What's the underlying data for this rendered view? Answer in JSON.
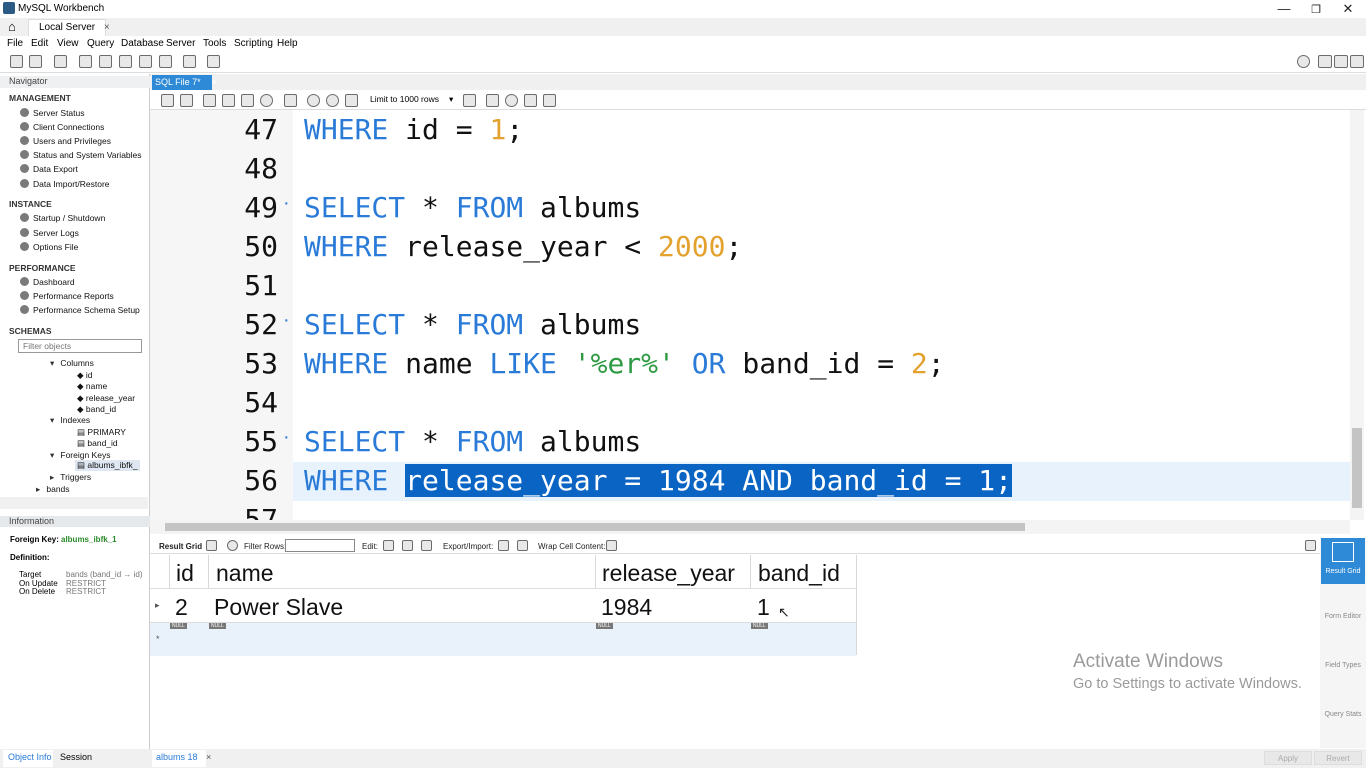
{
  "window": {
    "title": "MySQL Workbench",
    "minimize": "—",
    "restore": "❐",
    "close": "✕"
  },
  "connection_tab": {
    "label": "Local Server",
    "close": "×",
    "home": "⌂"
  },
  "menu": [
    "File",
    "Edit",
    "View",
    "Query",
    "Database",
    "Server",
    "Tools",
    "Scripting",
    "Help"
  ],
  "navigator": {
    "title": "Navigator",
    "management_header": "MANAGEMENT",
    "management_items": [
      "Server Status",
      "Client Connections",
      "Users and Privileges",
      "Status and System Variables",
      "Data Export",
      "Data Import/Restore"
    ],
    "instance_header": "INSTANCE",
    "instance_items": [
      "Startup / Shutdown",
      "Server Logs",
      "Options File"
    ],
    "performance_header": "PERFORMANCE",
    "performance_items": [
      "Dashboard",
      "Performance Reports",
      "Performance Schema Setup"
    ],
    "schemas_header": "SCHEMAS",
    "filter_placeholder": "Filter objects",
    "tree": {
      "columns": "Columns",
      "col_id": "id",
      "col_name": "name",
      "col_release": "release_year",
      "col_band": "band_id",
      "indexes": "Indexes",
      "idx_primary": "PRIMARY",
      "idx_band": "band_id",
      "foreign_keys": "Foreign Keys",
      "fk": "albums_ibfk_",
      "triggers": "Triggers",
      "bands": "bands"
    }
  },
  "information": {
    "header": "Information",
    "fk_label": "Foreign Key:",
    "fk_value": "albums_ibfk_1",
    "definition": "Definition:",
    "target_label": "Target",
    "target_value": "bands (band_id → id)",
    "onupdate_label": "On Update",
    "onupdate_value": "RESTRICT",
    "ondelete_label": "On Delete",
    "ondelete_value": "RESTRICT"
  },
  "bottom_tabs": {
    "object_info": "Object Info",
    "session": "Session"
  },
  "sql_tab": {
    "label": "SQL File 7*",
    "close": "×"
  },
  "editor_toolbar": {
    "limit": "Limit to 1000 rows"
  },
  "editor": {
    "lines": [
      {
        "n": "47",
        "code": [
          {
            "t": "WHERE",
            "c": "kw"
          },
          {
            "t": " id = ",
            "c": ""
          },
          {
            "t": "1",
            "c": "num"
          },
          {
            "t": ";",
            "c": ""
          }
        ]
      },
      {
        "n": "48",
        "code": []
      },
      {
        "n": "49",
        "code": [
          {
            "t": "SELECT",
            "c": "kw"
          },
          {
            "t": " * ",
            "c": ""
          },
          {
            "t": "FROM",
            "c": "kw"
          },
          {
            "t": " albums",
            "c": ""
          }
        ],
        "dot": true
      },
      {
        "n": "50",
        "code": [
          {
            "t": "WHERE",
            "c": "kw"
          },
          {
            "t": " release_year < ",
            "c": ""
          },
          {
            "t": "2000",
            "c": "num"
          },
          {
            "t": ";",
            "c": ""
          }
        ]
      },
      {
        "n": "51",
        "code": []
      },
      {
        "n": "52",
        "code": [
          {
            "t": "SELECT",
            "c": "kw"
          },
          {
            "t": " * ",
            "c": ""
          },
          {
            "t": "FROM",
            "c": "kw"
          },
          {
            "t": " albums",
            "c": ""
          }
        ],
        "dot": true
      },
      {
        "n": "53",
        "code": [
          {
            "t": "WHERE",
            "c": "kw"
          },
          {
            "t": " name ",
            "c": ""
          },
          {
            "t": "LIKE",
            "c": "kw"
          },
          {
            "t": " ",
            "c": ""
          },
          {
            "t": "'%er%'",
            "c": "str"
          },
          {
            "t": " ",
            "c": ""
          },
          {
            "t": "OR",
            "c": "kw"
          },
          {
            "t": " band_id = ",
            "c": ""
          },
          {
            "t": "2",
            "c": "num"
          },
          {
            "t": ";",
            "c": ""
          }
        ]
      },
      {
        "n": "54",
        "code": []
      },
      {
        "n": "55",
        "code": [
          {
            "t": "SELECT",
            "c": "kw"
          },
          {
            "t": " * ",
            "c": ""
          },
          {
            "t": "FROM",
            "c": "kw"
          },
          {
            "t": " albums",
            "c": ""
          }
        ],
        "dot": true
      },
      {
        "n": "56",
        "code": [
          {
            "t": "WHERE",
            "c": "kw"
          },
          {
            "t": " ",
            "c": ""
          },
          {
            "t": "release_year = 1984 AND band_id = 1;",
            "c": "sel"
          }
        ]
      },
      {
        "n": "57",
        "code": []
      }
    ]
  },
  "result_toolbar": {
    "result_grid": "Result Grid",
    "filter_rows": "Filter Rows:",
    "edit": "Edit:",
    "export": "Export/Import:",
    "wrap": "Wrap Cell Content:"
  },
  "result_grid": {
    "columns": [
      "id",
      "name",
      "release_year",
      "band_id"
    ],
    "rows": [
      [
        "2",
        "Power Slave",
        "1984",
        "1"
      ]
    ],
    "null_label": "NULL",
    "new_row_marker": "*"
  },
  "side_buttons": {
    "result_grid": "Result Grid",
    "form_editor": "Form Editor",
    "field_types": "Field Types",
    "query_stats": "Query Stats"
  },
  "result_tab": {
    "label": "albums 18",
    "close": "×"
  },
  "bottom_buttons": {
    "apply": "Apply",
    "revert": "Revert"
  },
  "watermark": {
    "line1": "Activate Windows",
    "line2": "Go to Settings to activate Windows."
  }
}
